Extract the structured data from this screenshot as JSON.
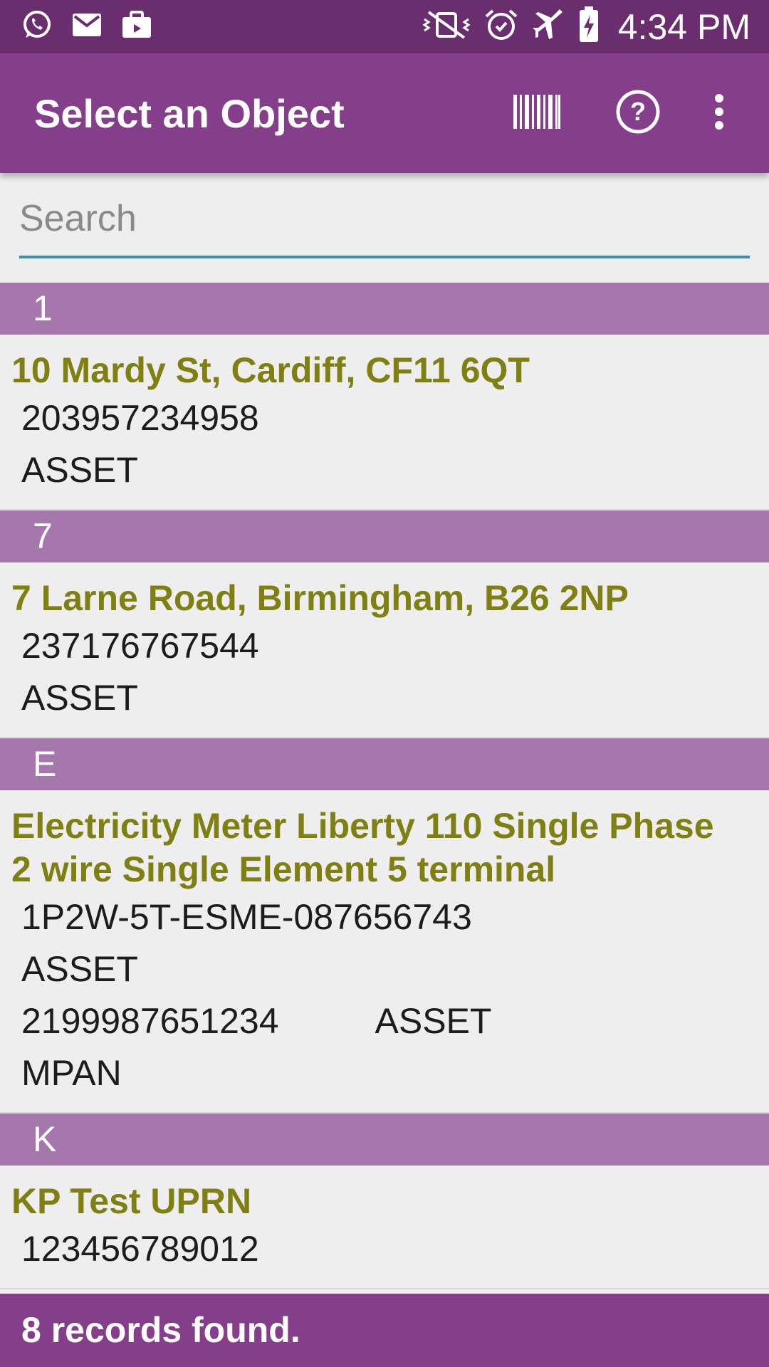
{
  "status_bar": {
    "time": "4:34 PM",
    "left_icons": [
      "whatsapp-icon",
      "email-icon",
      "briefcase-icon"
    ],
    "right_icons": [
      "mute-vibrate-icon",
      "alarm-icon",
      "airplane-mode-icon",
      "battery-charging-icon"
    ]
  },
  "app_bar": {
    "title": "Select an Object",
    "actions": [
      "barcode-icon",
      "help-icon",
      "overflow-menu-icon"
    ]
  },
  "search": {
    "placeholder": "Search",
    "value": ""
  },
  "sections": [
    {
      "header": "1",
      "items": [
        {
          "title": "10 Mardy St, Cardiff, CF11 6QT",
          "lines": [
            [
              "203957234958"
            ],
            [
              "ASSET"
            ]
          ]
        }
      ]
    },
    {
      "header": "7",
      "items": [
        {
          "title": "7 Larne Road, Birmingham, B26 2NP",
          "lines": [
            [
              "237176767544"
            ],
            [
              "ASSET"
            ]
          ]
        }
      ]
    },
    {
      "header": "E",
      "items": [
        {
          "title": "Electricity Meter Liberty 110 Single Phase 2 wire Single Element 5 terminal",
          "lines": [
            [
              "1P2W-5T-ESME-087656743"
            ],
            [
              "ASSET"
            ],
            [
              "2199987651234",
              "ASSET"
            ],
            [
              "MPAN"
            ]
          ]
        }
      ]
    },
    {
      "header": "K",
      "items": [
        {
          "title": "KP Test UPRN",
          "lines": [
            [
              "123456789012"
            ]
          ]
        }
      ]
    }
  ],
  "footer": {
    "status_text": "8 records found."
  },
  "colors": {
    "status_bar": "#6a2e6e",
    "app_bar": "#853e8a",
    "section_header": "#a677ad",
    "item_title": "#7f7f12",
    "search_underline": "#3d8fb5"
  }
}
